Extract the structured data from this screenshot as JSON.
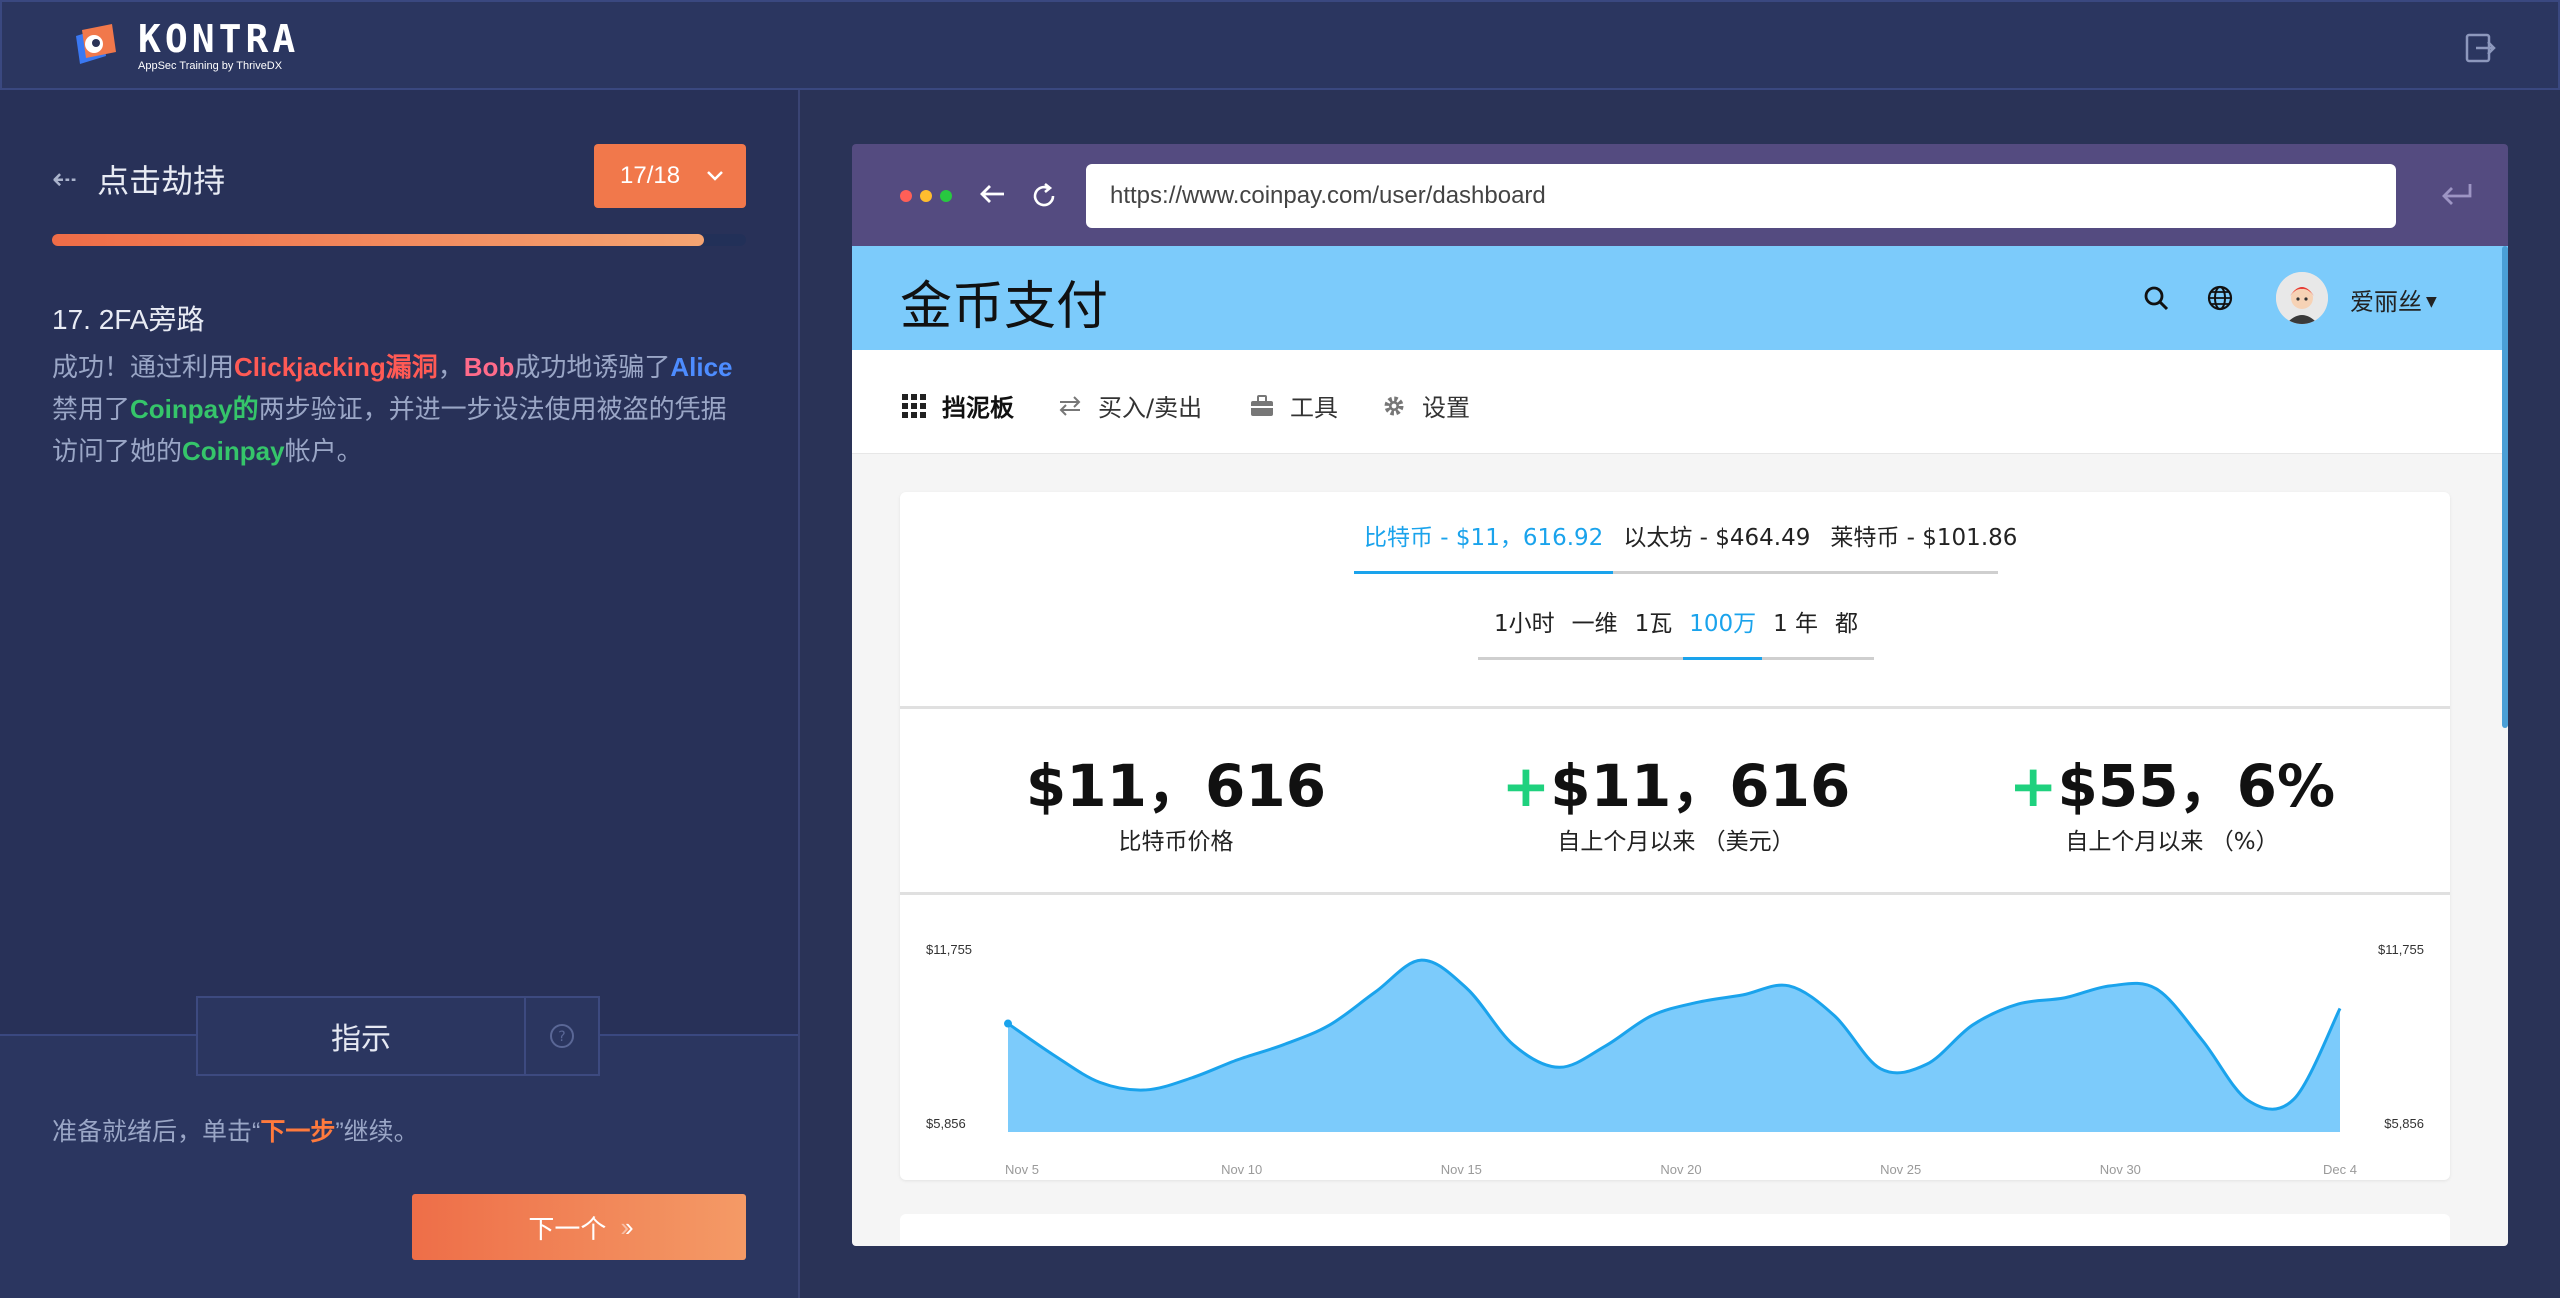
{
  "brand": {
    "title": "KONTRA",
    "subtitle": "AppSec Training by ThriveDX",
    "accent": "#f1784b"
  },
  "lesson": {
    "back_icon": "arrow-left-icon",
    "title": "点击劫持",
    "step_indicator": "17/18",
    "progress_percent": 94,
    "step_heading": "17. 2FA旁路",
    "body": {
      "p1": "成功！通过利用",
      "p2": "Clickjacking漏洞",
      "p3": "，",
      "p4": "Bob",
      "p5": "成功地诱骗了",
      "p6": "Alice",
      "p7": "禁用了",
      "p8": "Coinpay的",
      "p9": "两步验证，并进一步设法使用被盗的凭据访问了她的",
      "p10": "Coinpay",
      "p11": "帐户。"
    },
    "hint_label": "指示",
    "ready_pre": "准备就绪后，单击“",
    "ready_link": "下一步",
    "ready_post": "”继续。",
    "next_label": "下一个"
  },
  "browser": {
    "url": "https://www.coinpay.com/user/dashboard",
    "dot_colors": [
      "#ff5f57",
      "#ffbd2e",
      "#28c840"
    ]
  },
  "site": {
    "title": "金币支付",
    "user_name": "爱丽丝",
    "nav": [
      {
        "label": "挡泥板",
        "icon": "grid-icon"
      },
      {
        "label": "买入/卖出",
        "icon": "exchange-icon"
      },
      {
        "label": "工具",
        "icon": "briefcase-icon"
      },
      {
        "label": "设置",
        "icon": "gear-icon"
      }
    ],
    "coin_tabs": [
      "比特币 - $11，616.92",
      "以太坊 - $464.49",
      "莱特币 - $101.86"
    ],
    "range_tabs": [
      "1小时",
      "一维",
      "1瓦",
      "100万",
      "1 年",
      "都"
    ],
    "active_range": 3,
    "stats": [
      {
        "value": "$11，616",
        "plus": "",
        "label": "比特币价格"
      },
      {
        "value": "$11，616",
        "plus": "+",
        "label": "自上个月以来 （美元）"
      },
      {
        "value": "$55，6%",
        "plus": "+",
        "label": "自上个月以来 （%）"
      }
    ]
  },
  "chart_data": {
    "type": "area",
    "ylim": [
      5856,
      11755
    ],
    "y_tick_labels": [
      "$11,755",
      "$5,856"
    ],
    "x_tick_labels": [
      "Nov 5",
      "Nov 10",
      "Nov 15",
      "Nov 20",
      "Nov 25",
      "Nov 30",
      "Dec 4"
    ],
    "x": [
      5,
      6,
      7,
      8,
      9,
      10,
      11,
      12,
      13,
      14,
      15,
      16,
      17,
      18,
      19,
      20,
      21,
      22,
      23,
      24,
      25,
      26,
      27,
      28,
      29,
      30,
      31,
      32,
      33,
      34
    ],
    "series": [
      {
        "values": [
          9450,
          8400,
          7500,
          7250,
          7650,
          8250,
          8750,
          9400,
          10500,
          11550,
          10600,
          8750,
          8000,
          8700,
          9700,
          10150,
          10400,
          10700,
          9700,
          7950,
          8100,
          9400,
          10100,
          10300,
          10700,
          10600,
          8900,
          6900,
          6950,
          9950
        ],
        "color": "#7ccbfb"
      }
    ]
  }
}
